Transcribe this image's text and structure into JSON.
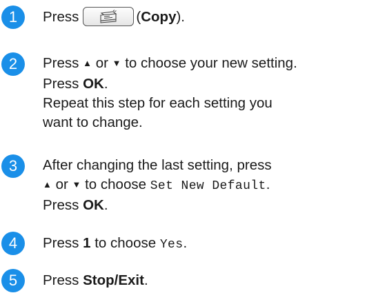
{
  "colors": {
    "badge": "#1a8fe8",
    "text": "#1a1a1a"
  },
  "steps": [
    {
      "number": "1",
      "press": "Press",
      "key_icon": "copy-machine-icon",
      "paren_open": "(",
      "key_name": "Copy",
      "paren_close": ")."
    },
    {
      "number": "2",
      "press_before": "Press",
      "up_arrow": "▲",
      "or": "or",
      "down_arrow": "▼",
      "choose_text": "to choose your new setting.",
      "press_ok_prefix": "Press",
      "ok": "OK",
      "period": ".",
      "repeat_line1": "Repeat this step for each setting you",
      "repeat_line2": "want to change."
    },
    {
      "number": "3",
      "line1": "After changing the last setting, press",
      "up_arrow": "▲",
      "or": "or",
      "down_arrow": "▼",
      "choose_text": "to choose",
      "menu_value": "Set New Default",
      "period": ".",
      "press_ok_prefix": "Press",
      "ok": "OK",
      "period2": "."
    },
    {
      "number": "4",
      "press": "Press",
      "key": "1",
      "choose_text": "to choose",
      "value": "Yes",
      "period": "."
    },
    {
      "number": "5",
      "press": "Press",
      "key": "Stop/Exit",
      "period": "."
    }
  ]
}
